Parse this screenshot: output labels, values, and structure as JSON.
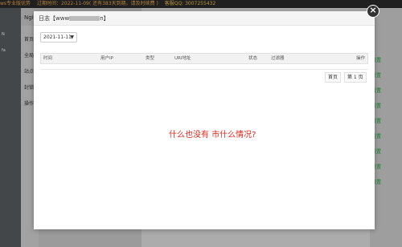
{
  "background": {
    "topbar": {
      "edition": "ws专业版优势",
      "expiry": "过期时间：2022-11-09( 还有383天到期，请及时续费 )",
      "qq": "客服QQ: 3007255432"
    },
    "left_items": [
      "N",
      "fa"
    ],
    "subnav": {
      "title": "Ngi",
      "items": [
        "首页",
        "全局",
        "站点",
        "封锁",
        "操作"
      ]
    },
    "right_buttons": [
      "设置",
      "设置",
      "设置",
      "设置",
      "设置",
      "设置",
      "设置",
      "设置",
      "设置"
    ]
  },
  "modal": {
    "title_prefix": "日志【www",
    "title_suffix": "n】",
    "date_filter": "2021-11-11",
    "columns": [
      "时间",
      "用户IP",
      "类型",
      "URI地址",
      "状态",
      "过滤器",
      "操作"
    ],
    "pager": {
      "first": "首页",
      "current": "第 1 页"
    },
    "annotation": "什么也没有 市什么情况?"
  },
  "colors": {
    "annotation": "#e0261c",
    "set_button": "#1aab3d",
    "topbar": "#2b2b2b"
  },
  "icons": {
    "close": "close-icon",
    "chevron": "chevron-down-icon"
  }
}
